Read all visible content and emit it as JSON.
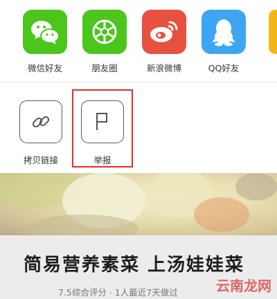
{
  "share_targets": [
    {
      "label": "微信好友",
      "icon": "wechat-icon",
      "color": "#4cc51c"
    },
    {
      "label": "朋友圈",
      "icon": "moments-icon",
      "color": "#4cc51c"
    },
    {
      "label": "新浪微博",
      "icon": "weibo-icon",
      "color": "#e8503f"
    },
    {
      "label": "QQ好友",
      "icon": "qq-icon",
      "color": "#3ca6f2"
    }
  ],
  "actions": [
    {
      "label": "拷贝链接",
      "icon": "link-icon"
    },
    {
      "label": "举报",
      "icon": "report-icon"
    }
  ],
  "recipe": {
    "title": "简易营养素菜 上汤娃娃菜",
    "meta": "7.5综合评分 · 1人最近7天做过"
  },
  "watermark": "云南龙网"
}
